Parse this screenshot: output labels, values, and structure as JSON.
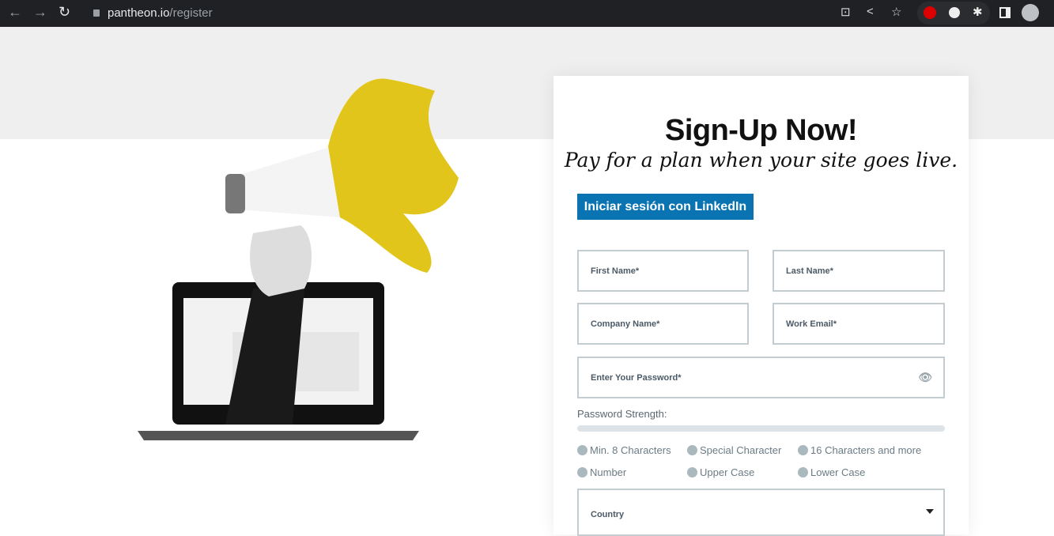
{
  "browser": {
    "url_host": "pantheon.io",
    "url_path": "/register"
  },
  "form": {
    "title": "Sign-Up Now!",
    "subtitle": "Pay for a plan when your site goes live.",
    "linkedin_label": "Iniciar sesión con LinkedIn",
    "first_name": "First Name*",
    "last_name": "Last Name*",
    "company": "Company Name*",
    "email": "Work Email*",
    "password": "Enter Your Password*",
    "strength_label": "Password Strength:",
    "strength_value": 0,
    "requirements": [
      "Min. 8 Characters",
      "Special Character",
      "16 Characters and more",
      "Number",
      "Upper Case",
      "Lower Case"
    ],
    "country": "Country"
  },
  "colors": {
    "linkedin": "#0a73b1",
    "accent_yellow": "#e2c51a"
  }
}
